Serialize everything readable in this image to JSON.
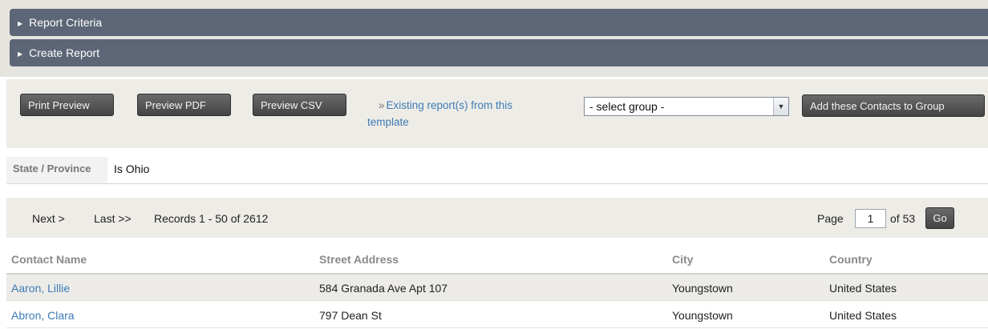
{
  "accordions": [
    {
      "label": "Report Criteria"
    },
    {
      "label": "Create Report"
    }
  ],
  "actions": {
    "print_preview": "Print Preview",
    "preview_pdf": "Preview PDF",
    "preview_csv": "Preview CSV",
    "existing_link_prefix": "»",
    "existing_link": "Existing report(s) from this template",
    "group_select_value": "- select group -",
    "add_to_group": "Add these Contacts to Group"
  },
  "filter": {
    "label": "State / Province",
    "value": "Is Ohio"
  },
  "pager": {
    "next": "Next >",
    "last": "Last >>",
    "records": "Records 1 - 50 of 2612",
    "page_label": "Page",
    "page_value": "1",
    "of_label": "of 53",
    "go": "Go"
  },
  "table": {
    "headers": [
      "Contact Name",
      "Street Address",
      "City",
      "Country"
    ],
    "rows": [
      [
        "Aaron, Lillie",
        "584 Granada Ave Apt 107",
        "Youngstown",
        "United States"
      ],
      [
        "Abron, Clara",
        "797 Dean St",
        "Youngstown",
        "United States"
      ]
    ]
  }
}
